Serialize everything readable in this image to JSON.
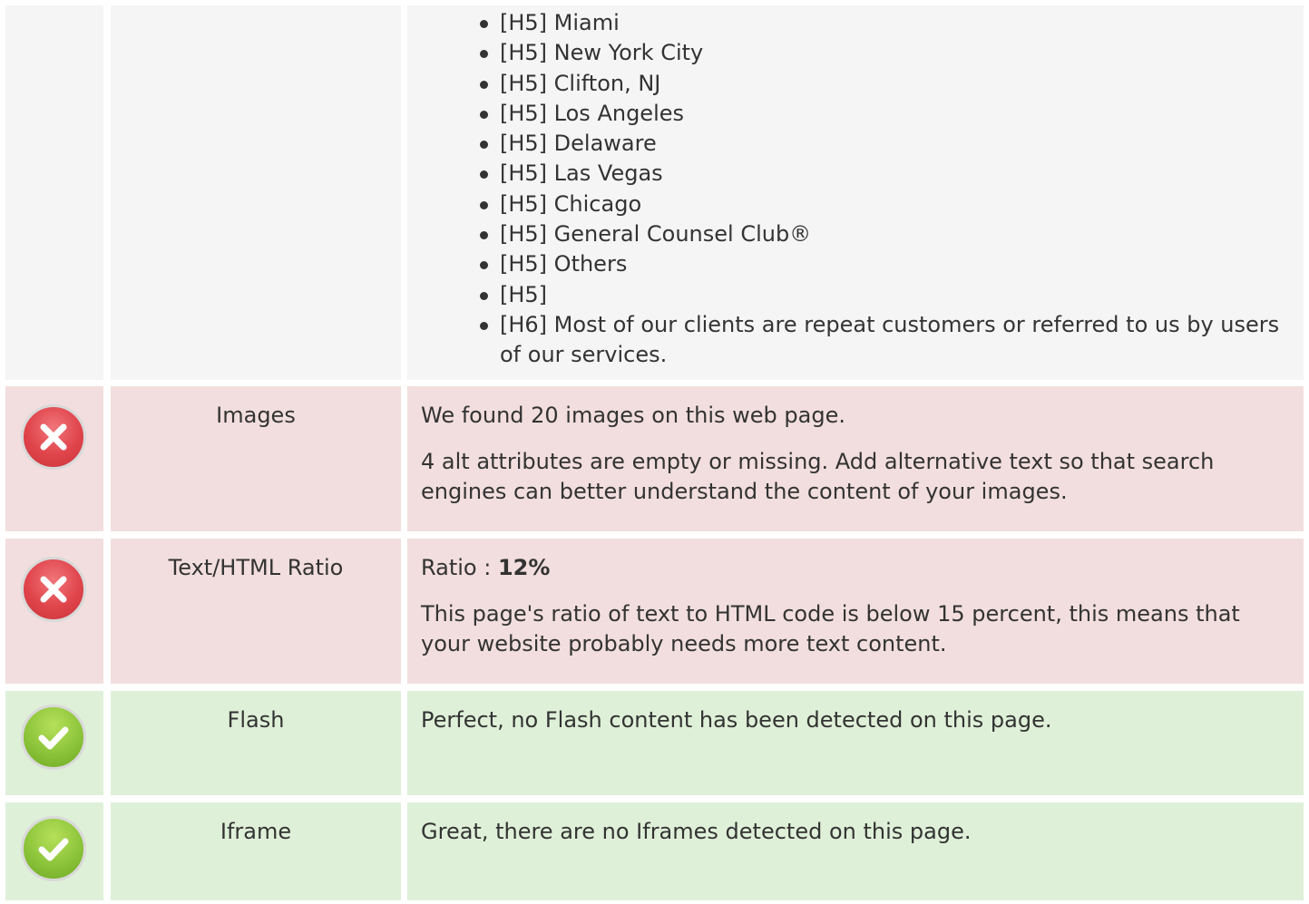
{
  "headings_row": {
    "items": [
      "[H5] Miami",
      "[H5] New York City",
      "[H5] Clifton, NJ",
      "[H5] Los Angeles",
      "[H5] Delaware",
      "[H5] Las Vegas",
      "[H5] Chicago",
      "[H5] General Counsel Club®",
      "[H5] Others",
      "[H5]",
      "[H6] Most of our clients are repeat customers or referred to us by users of our services."
    ]
  },
  "checks": [
    {
      "status": "fail",
      "status_icon": "error-x-icon",
      "label": "Images",
      "paragraphs": [
        "We found 20 images on this web page.",
        "4 alt attributes are empty or missing. Add alternative text so that search engines can better understand the content of your images."
      ]
    },
    {
      "status": "fail",
      "status_icon": "error-x-icon",
      "label": "Text/HTML Ratio",
      "ratio_prefix": "Ratio : ",
      "ratio_value": "12%",
      "paragraphs": [
        "This page's ratio of text to HTML code is below 15 percent, this means that your website probably needs more text content."
      ]
    },
    {
      "status": "pass",
      "status_icon": "checkmark-icon",
      "label": "Flash",
      "paragraphs": [
        "Perfect, no Flash content has been detected on this page."
      ]
    },
    {
      "status": "pass",
      "status_icon": "checkmark-icon",
      "label": "Iframe",
      "paragraphs": [
        "Great, there are no Iframes detected on this page."
      ]
    }
  ],
  "colors": {
    "fail_background": "#f2dede",
    "pass_background": "#dff0d8",
    "neutral_background": "#f5f5f5",
    "fail_icon": "#e0444b",
    "pass_icon": "#8cc43a"
  }
}
